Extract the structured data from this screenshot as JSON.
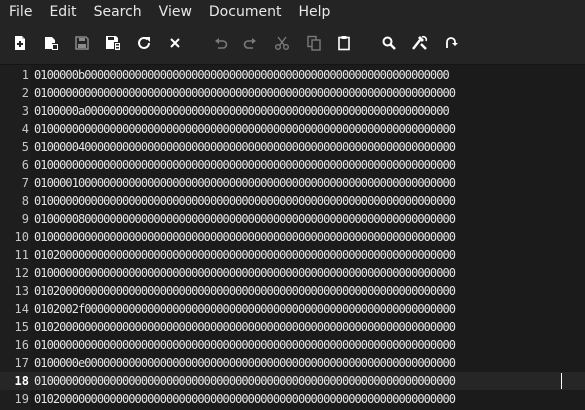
{
  "menu": {
    "file": "File",
    "edit": "Edit",
    "search": "Search",
    "view": "View",
    "document": "Document",
    "help": "Help"
  },
  "toolbar": {
    "icons": [
      "new-file-icon",
      "open-file-icon",
      "save-icon",
      "save-as-icon",
      "reload-icon",
      "close-icon",
      "undo-icon",
      "redo-icon",
      "cut-icon",
      "copy-icon",
      "paste-icon",
      "find-icon",
      "find-replace-icon",
      "goto-line-icon"
    ]
  },
  "editor": {
    "current_line": 18,
    "lines": [
      {
        "num": "1",
        "text": "0100000b0000000000000000000000000000000000000000000000000000000000"
      },
      {
        "num": "2",
        "text": "0100000000000000000000000000000000000000000000000000000000000000000"
      },
      {
        "num": "3",
        "text": "0100000a0000000000000000000000000000000000000000000000000000000000"
      },
      {
        "num": "4",
        "text": "0100000000000000000000000000000000000000000000000000000000000000000"
      },
      {
        "num": "5",
        "text": "0100000400000000000000000000000000000000000000000000000000000000000"
      },
      {
        "num": "6",
        "text": "0100000000000000000000000000000000000000000000000000000000000000000"
      },
      {
        "num": "7",
        "text": "0100001000000000000000000000000000000000000000000000000000000000000"
      },
      {
        "num": "8",
        "text": "0100000000000000000000000000000000000000000000000000000000000000000"
      },
      {
        "num": "9",
        "text": "0100000800000000000000000000000000000000000000000000000000000000000"
      },
      {
        "num": "10",
        "text": "0100000000000000000000000000000000000000000000000000000000000000000"
      },
      {
        "num": "11",
        "text": "0102000000000000000000000000000000000000000000000000000000000000000"
      },
      {
        "num": "12",
        "text": "0100000000000000000000000000000000000000000000000000000000000000000"
      },
      {
        "num": "13",
        "text": "0102000000000000000000000000000000000000000000000000000000000000000"
      },
      {
        "num": "14",
        "text": "0102002f00000000000000000000000000000000000000000000000000000000000"
      },
      {
        "num": "15",
        "text": "0102000000000000000000000000000000000000000000000000000000000000000"
      },
      {
        "num": "16",
        "text": "0100000000000000000000000000000000000000000000000000000000000000000"
      },
      {
        "num": "17",
        "text": "0100000e00000000000000000000000000000000000000000000000000000000000"
      },
      {
        "num": "18",
        "text": "0100000000000000000000000000000000000000000000000000000000000000000"
      },
      {
        "num": "19",
        "text": "0102000000000000000000000000000000000000000000000000000000000000000"
      }
    ]
  }
}
